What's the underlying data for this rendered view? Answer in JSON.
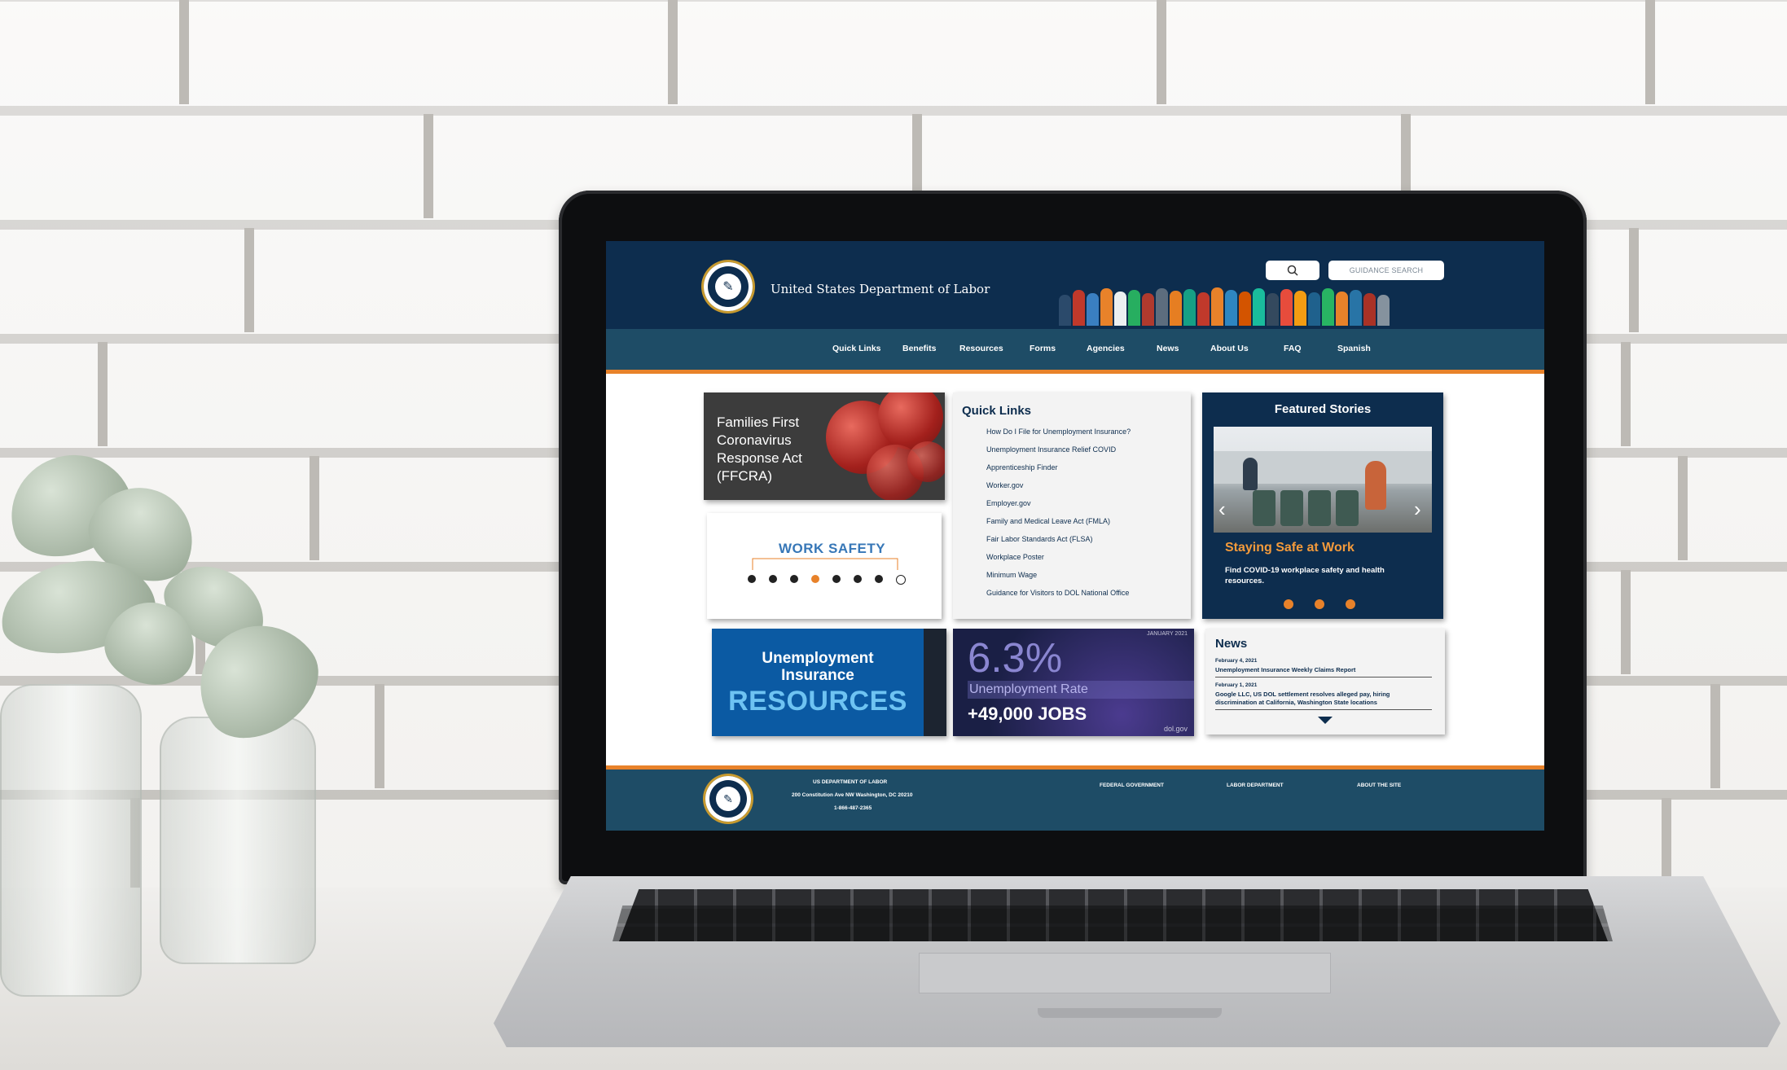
{
  "site": {
    "title": "United States Department of Labor",
    "search_icon": "search-icon",
    "guidance_search": "GUIDANCE SEARCH"
  },
  "nav": {
    "items": [
      {
        "label": "Quick Links"
      },
      {
        "label": "Benefits"
      },
      {
        "label": "Resources"
      },
      {
        "label": "Forms"
      },
      {
        "label": "Agencies"
      },
      {
        "label": "News"
      },
      {
        "label": "About Us"
      },
      {
        "label": "FAQ"
      },
      {
        "label": "Spanish"
      }
    ]
  },
  "ffcra": {
    "line1": "Families First",
    "line2": "Coronavirus",
    "line3": "Response Act",
    "line4": "(FFCRA)"
  },
  "work_safety": {
    "title": "WORK SAFETY"
  },
  "quick_links": {
    "title": "Quick Links",
    "items": [
      {
        "label": "How Do I File for Unemployment Insurance?"
      },
      {
        "label": "Unemployment Insurance Relief COVID"
      },
      {
        "label": "Apprenticeship Finder"
      },
      {
        "label": "Worker.gov"
      },
      {
        "label": "Employer.gov"
      },
      {
        "label": "Family and Medical Leave Act (FMLA)"
      },
      {
        "label": "Fair Labor Standards Act (FLSA)"
      },
      {
        "label": "Workplace Poster"
      },
      {
        "label": "Minimum Wage"
      },
      {
        "label": "Guidance for Visitors to DOL National Office"
      }
    ]
  },
  "featured": {
    "title": "Featured Stories",
    "story_title": "Staying Safe at Work",
    "story_body": "Find COVID-19 workplace safety and health resources.",
    "prev_icon": "chevron-left-icon",
    "next_icon": "chevron-right-icon"
  },
  "ui_resources": {
    "line1": "Unemployment",
    "line2": "Insurance",
    "line3": "RESOURCES"
  },
  "unemployment_rate": {
    "month": "JANUARY 2021",
    "percent": "6.3%",
    "label": "Unemployment Rate",
    "jobs": "+49,000 JOBS",
    "site": "dol.gov"
  },
  "news": {
    "title": "News",
    "items": [
      {
        "date": "February 4, 2021",
        "headline": "Unemployment Insurance Weekly Claims Report"
      },
      {
        "date": "February 1, 2021",
        "headline": "Google LLC, US DOL settlement resolves alleged pay, hiring discrimination at California, Washington State locations"
      }
    ]
  },
  "footer": {
    "org": "US DEPARTMENT OF LABOR",
    "address": "200 Constitution Ave NW Washington, DC 20210",
    "phone": "1-866-487-2365",
    "links": [
      {
        "label": "FEDERAL GOVERNMENT"
      },
      {
        "label": "LABOR DEPARTMENT"
      },
      {
        "label": "ABOUT THE SITE"
      }
    ]
  },
  "colors": {
    "navy": "#0d2d4e",
    "teal": "#1e4c66",
    "orange": "#e8822a"
  }
}
